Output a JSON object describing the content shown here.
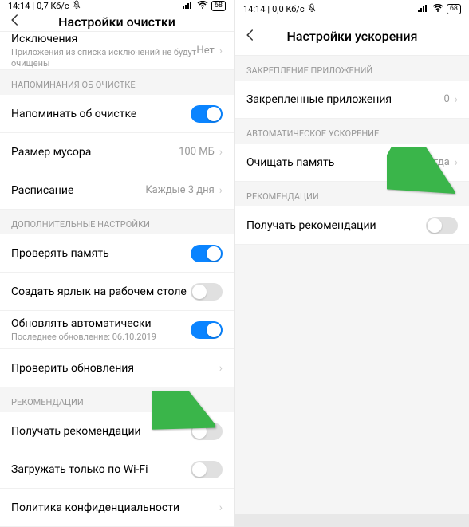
{
  "left": {
    "status": {
      "time": "14:14",
      "speed": "0,7 Кб/с",
      "battery": "68"
    },
    "header": {
      "title": "Настройки очистки"
    },
    "exclusions": {
      "title": "Исключения",
      "sub": "Приложения из списка исключений не будут очищены",
      "value": "Нет"
    },
    "sec_reminders": "НАПОМИНАНИЯ ОБ ОЧИСТКЕ",
    "remind": {
      "title": "Напоминать об очистке"
    },
    "trash_size": {
      "title": "Размер мусора",
      "value": "100 МБ"
    },
    "schedule": {
      "title": "Расписание",
      "value": "Каждые 3 дня"
    },
    "sec_additional": "ДОПОЛНИТЕЛЬНЫЕ НАСТРОЙКИ",
    "check_memory": {
      "title": "Проверять память"
    },
    "shortcut": {
      "title": "Создать ярлык на рабочем столе"
    },
    "autoupdate": {
      "title": "Обновлять автоматически",
      "sub": "Последнее обновление: 06.10.2019"
    },
    "check_updates": {
      "title": "Проверить обновления"
    },
    "sec_recommend": "РЕКОМЕНДАЦИИ",
    "recommend": {
      "title": "Получать рекомендации"
    },
    "wifi_only": {
      "title": "Загружать только по Wi-Fi"
    },
    "privacy": {
      "title": "Политика конфиденциальности"
    }
  },
  "right": {
    "status": {
      "time": "14:14",
      "speed": "0,0 Кб/с",
      "battery": "68"
    },
    "header": {
      "title": "Настройки ускорения"
    },
    "sec_pinned": "ЗАКРЕПЛЕНИЕ ПРИЛОЖЕНИЙ",
    "pinned": {
      "title": "Закрепленные приложения",
      "value": "0"
    },
    "sec_auto": "АВТОМАТИЧЕСКОЕ УСКОРЕНИЕ",
    "clear_memory": {
      "title": "Очищать память",
      "value": "Никогда"
    },
    "sec_recommend": "РЕКОМЕНДАЦИИ",
    "recommend": {
      "title": "Получать рекомендации"
    }
  }
}
